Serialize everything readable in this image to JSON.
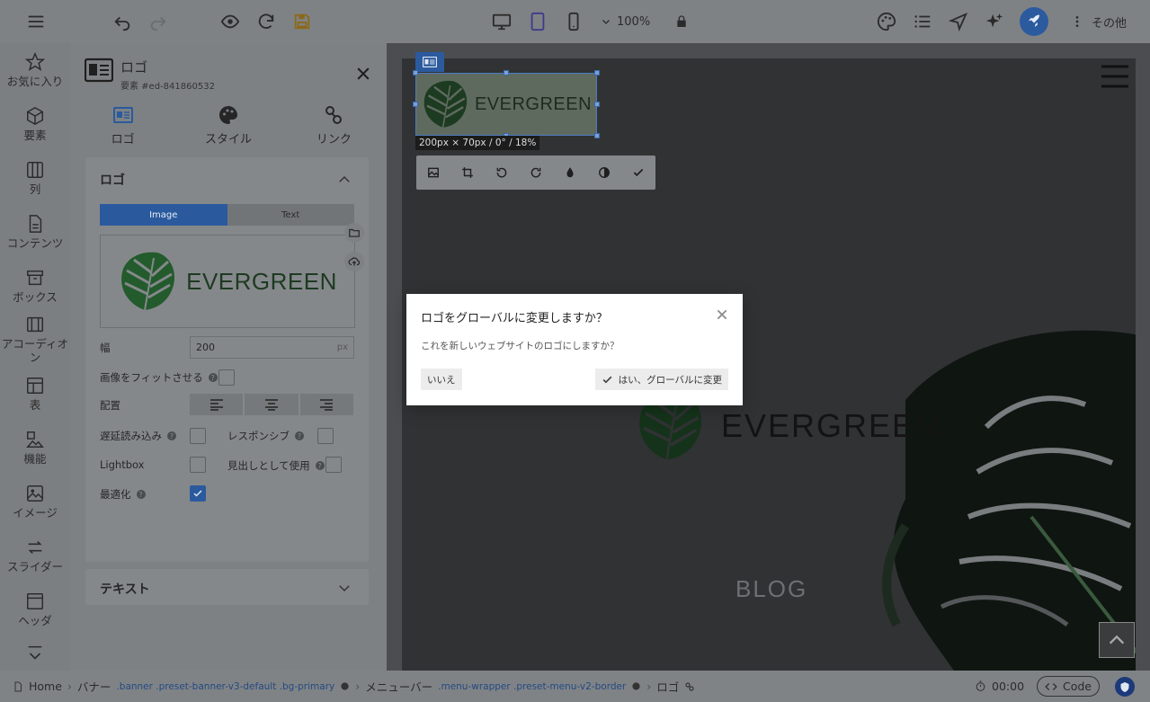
{
  "toolbar": {
    "zoom": "100%",
    "more_label": "その他"
  },
  "rail": {
    "items": [
      {
        "label": "お気に入り",
        "icon": "star-icon"
      },
      {
        "label": "要素",
        "icon": "cube-icon"
      },
      {
        "label": "列",
        "icon": "columns-icon"
      },
      {
        "label": "コンテンツ",
        "icon": "document-icon"
      },
      {
        "label": "ボックス",
        "icon": "box-icon"
      },
      {
        "label": "アコーディオン",
        "icon": "accordion-icon"
      },
      {
        "label": "表",
        "icon": "table-icon"
      },
      {
        "label": "機能",
        "icon": "features-icon"
      },
      {
        "label": "イメージ",
        "icon": "image-icon"
      },
      {
        "label": "スライダー",
        "icon": "slider-icon"
      },
      {
        "label": "ヘッダ",
        "icon": "header-icon"
      }
    ]
  },
  "panel": {
    "title": "ロゴ",
    "element_id": "要素 #ed-841860532",
    "tabs": [
      {
        "label": "ロゴ"
      },
      {
        "label": "スタイル"
      },
      {
        "label": "リンク"
      }
    ],
    "section_title": "ロゴ",
    "segment": {
      "image": "Image",
      "text": "Text"
    },
    "logo_text": "EVERGREEN",
    "width_label": "幅",
    "width_value": "200",
    "width_unit": "px",
    "fit_label": "画像をフィットさせる",
    "align_label": "配置",
    "lazy_label": "遅延読み込み",
    "responsive_label": "レスポンシブ",
    "lightbox_label": "Lightbox",
    "heading_label": "見出しとして使用",
    "optimize_label": "最適化",
    "text_section_title": "テキスト"
  },
  "canvas": {
    "logo_text": "EVERGREEN",
    "size_badge": "200px × 70px / 0° / 18%",
    "big_logo_text": "EVERGREEN",
    "blog_text": "BLOG"
  },
  "modal": {
    "title": "ロゴをグローバルに変更しますか？",
    "message": "これを新しいウェブサイトのロゴにしますか？",
    "no_label": "いいえ",
    "yes_label": "はい、グローバルに変更"
  },
  "breadcrumb": {
    "home": "Home",
    "banner": "バナー",
    "banner_classes": ".banner .preset-banner-v3-default .bg-primary",
    "menubar": "メニューバー",
    "menubar_classes": ".menu-wrapper .preset-menu-v2-border",
    "logo": "ロゴ",
    "timer": "00:00",
    "code_label": "Code"
  },
  "colors": {
    "accent": "#2c5a9e",
    "leaf": "#2e7d3a"
  }
}
